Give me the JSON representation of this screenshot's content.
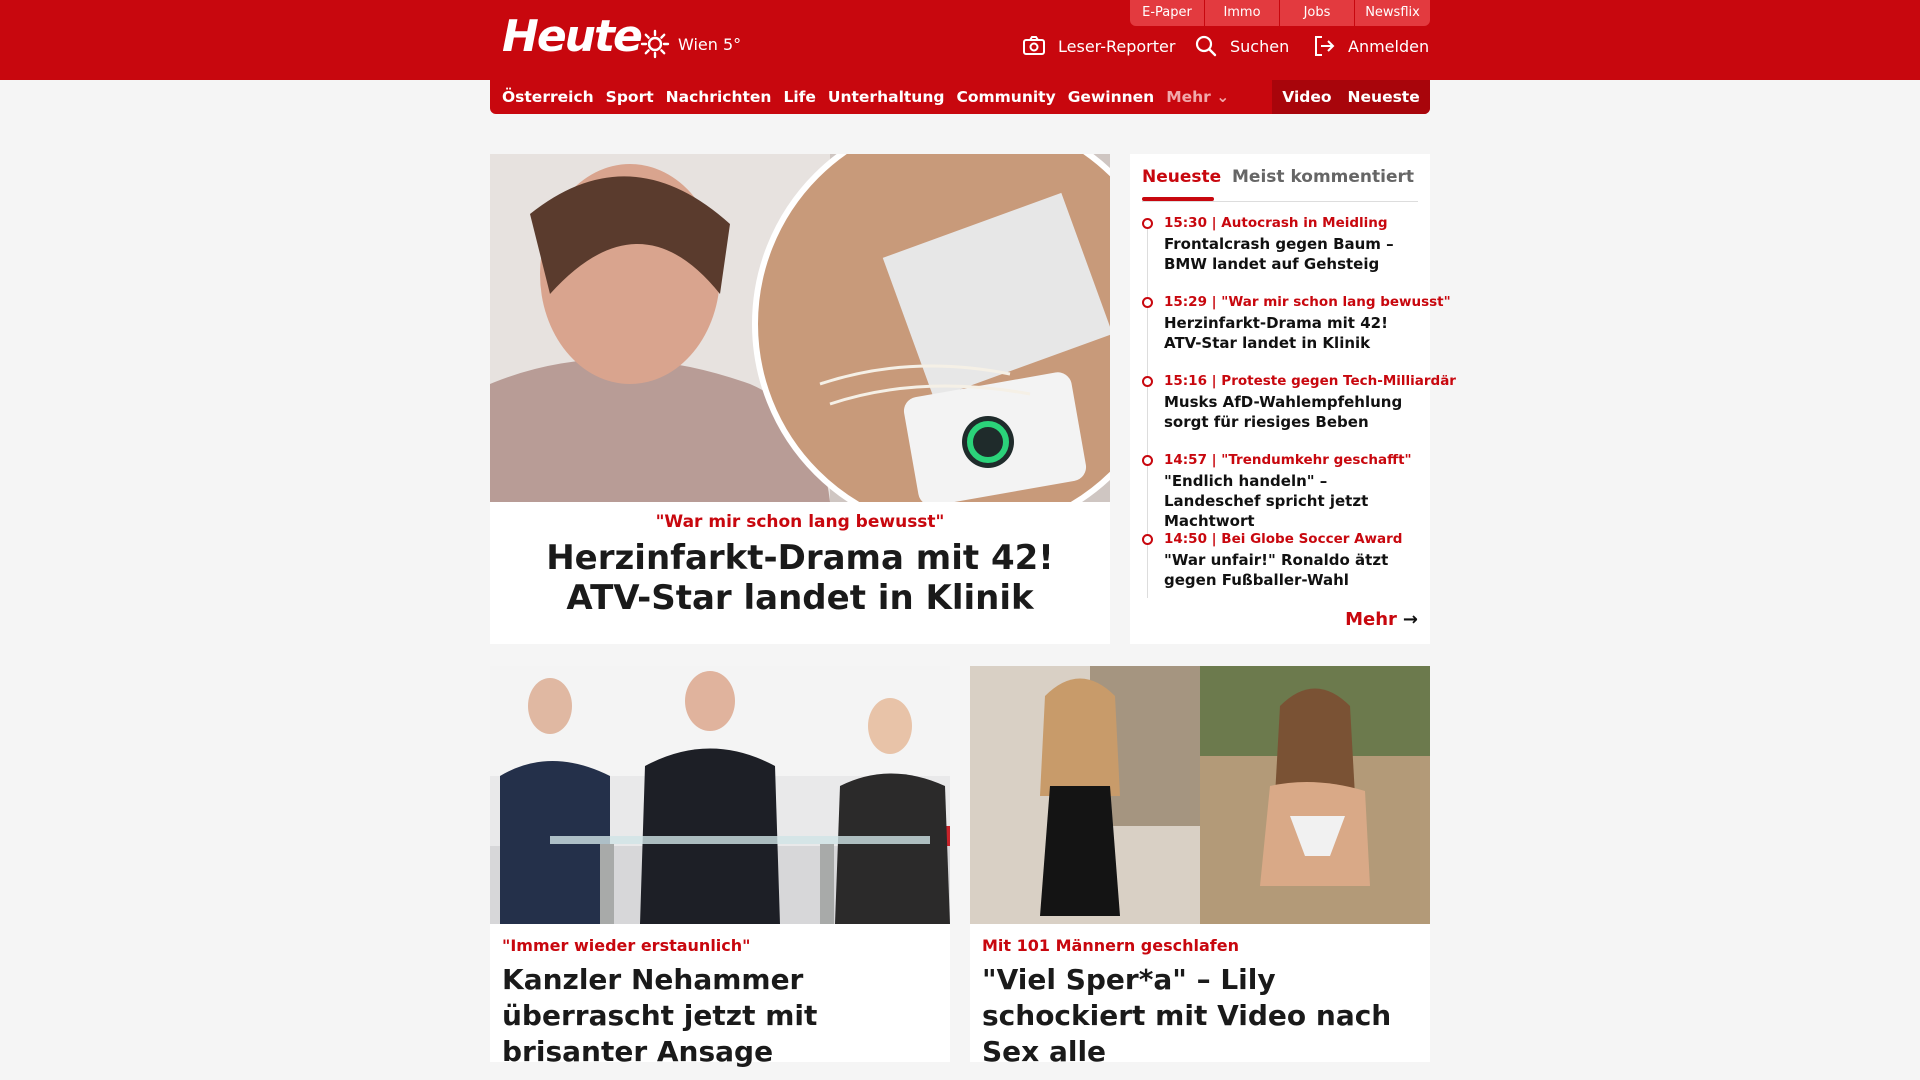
{
  "header": {
    "logo": "Heute",
    "weather": "Wien 5°",
    "top_links": [
      "E-Paper",
      "Immo",
      "Jobs",
      "Newsflix"
    ],
    "reporter": "Leser-Reporter",
    "search": "Suchen",
    "login": "Anmelden"
  },
  "nav": {
    "items": [
      "Österreich",
      "Sport",
      "Nachrichten",
      "Life",
      "Unterhaltung",
      "Community",
      "Gewinnen"
    ],
    "more": "Mehr",
    "right": [
      "Video",
      "Neueste"
    ]
  },
  "hero": {
    "kicker": "\"War mir schon lang bewusst\"",
    "title": "Herzinfarkt-Drama mit 42! ATV-Star landet in Klinik"
  },
  "side": {
    "tabs": [
      "Neueste",
      "Meist kommentiert"
    ],
    "items": [
      {
        "meta": "15:30 | Autocrash in Meidling",
        "title": "Frontalcrash gegen Baum – BMW landet auf Gehsteig"
      },
      {
        "meta": "15:29 | \"War mir schon lang bewusst\"",
        "title": "Herzinfarkt-Drama mit 42! ATV-Star landet in Klinik"
      },
      {
        "meta": "15:16 | Proteste gegen Tech-Milliardär",
        "title": "Musks AfD-Wahlempfehlung sorgt für riesiges Beben"
      },
      {
        "meta": "14:57 | \"Trendumkehr geschafft\"",
        "title": "\"Endlich handeln\" – Landeschef spricht jetzt Machtwort"
      },
      {
        "meta": "14:50 | Bei Globe Soccer Award",
        "title": "\"War unfair!\" Ronaldo ätzt gegen Fußballer-Wahl"
      }
    ],
    "more": "Mehr"
  },
  "cards": [
    {
      "kicker": "\"Immer wieder erstaunlich\"",
      "title": "Kanzler Nehammer überrascht jetzt mit brisanter Ansage"
    },
    {
      "kicker": "Mit 101 Männern geschlafen",
      "title": "\"Viel Sper*a\" – Lily schockiert mit Video nach Sex alle"
    }
  ],
  "colors": {
    "brand": "#c8070e",
    "background": "#f5f5f5"
  }
}
